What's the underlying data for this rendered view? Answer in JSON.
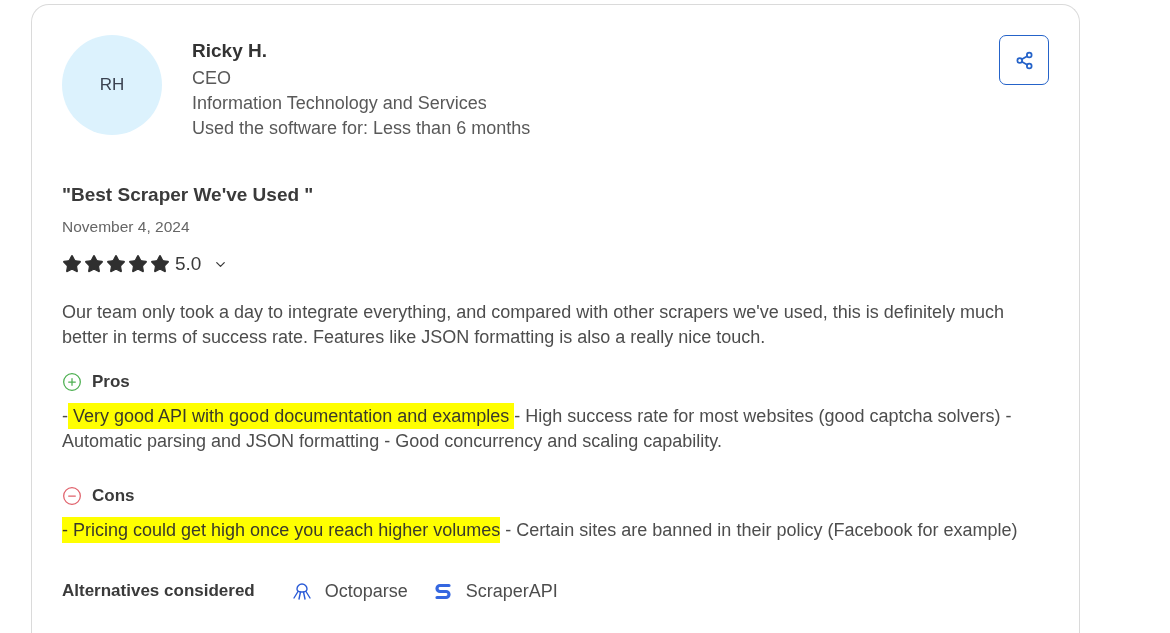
{
  "reviewer": {
    "initials": "RH",
    "name": "Ricky H.",
    "role": "CEO",
    "industry": "Information Technology and Services",
    "usage": "Used the software for: Less than 6 months"
  },
  "review": {
    "title": "\"Best Scraper We've Used \"",
    "date": "November 4, 2024",
    "stars": 5,
    "rating": "5.0",
    "body": "Our team only took a day to integrate everything, and compared with other scrapers we've used, this is definitely much better in terms of success rate. Features like JSON formatting is also a really nice touch."
  },
  "sections": [
    {
      "kind": "pros",
      "heading": "Pros",
      "segments": [
        {
          "text": "-",
          "highlighted": false
        },
        {
          "text": " Very good API with good documentation and examples ",
          "highlighted": true
        },
        {
          "text": "- High success rate for most websites (good captcha solvers) - Automatic parsing and JSON formatting - Good concurrency and scaling capability.",
          "highlighted": false
        }
      ]
    },
    {
      "kind": "cons",
      "heading": "Cons",
      "segments": [
        {
          "text": "- Pricing could get high once you reach higher volumes",
          "highlighted": true
        },
        {
          "text": " - Certain sites are banned in their policy (Facebook for example)",
          "highlighted": false
        }
      ]
    }
  ],
  "alternatives": {
    "label": "Alternatives considered",
    "items": [
      {
        "kind": "octopus",
        "name": "Octoparse"
      },
      {
        "kind": "monogram",
        "name": "ScraperAPI"
      }
    ]
  }
}
